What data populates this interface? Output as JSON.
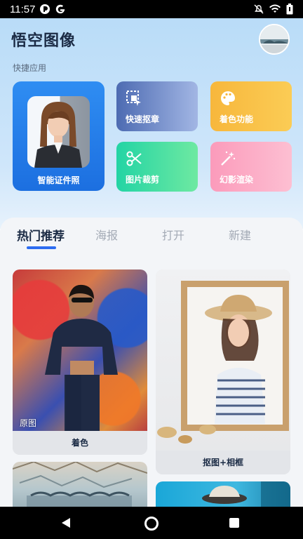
{
  "status_bar": {
    "time": "11:57"
  },
  "header": {
    "title": "悟空图像"
  },
  "quick_apps": {
    "label": "快捷应用",
    "featured": {
      "label": "智能证件照"
    },
    "tiles": [
      {
        "label": "快速抠章",
        "icon": "select-region-icon"
      },
      {
        "label": "着色功能",
        "icon": "palette-icon"
      },
      {
        "label": "图片裁剪",
        "icon": "scissors-icon"
      },
      {
        "label": "幻影渲染",
        "icon": "magic-wand-icon"
      }
    ]
  },
  "tabs": [
    {
      "label": "热门推荐",
      "active": true
    },
    {
      "label": "海报",
      "active": false
    },
    {
      "label": "打开",
      "active": false
    },
    {
      "label": "新建",
      "active": false
    }
  ],
  "feed": [
    {
      "label": "着色",
      "tag": "原图"
    },
    {
      "label": "抠图+相框"
    }
  ],
  "colors": {
    "accent": "#2c6cf1",
    "title": "#1b2b45",
    "inactive_tab": "#a3aab5"
  }
}
